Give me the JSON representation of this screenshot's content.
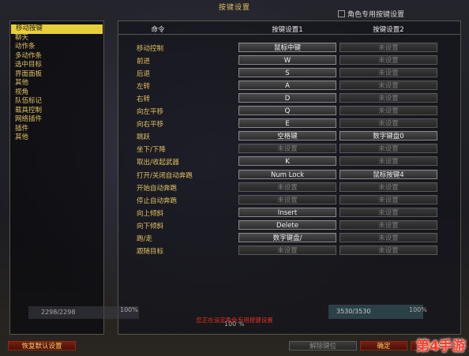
{
  "window_title": "按键设置",
  "role_keybind_label": "角色专用按键设置",
  "categories": [
    "移动按键",
    "聊天",
    "动作条",
    "多动作条",
    "选中目标",
    "界面面板",
    "其他",
    "视角",
    "队伍标记",
    "载具控制",
    "网络插件",
    "插件",
    "其他"
  ],
  "selected_category_index": 0,
  "table": {
    "headers": [
      "命令",
      "按键设置1",
      "按键设置2"
    ],
    "rows": [
      {
        "command": "移动控制",
        "key1": "鼠标中键",
        "key2": "未设置"
      },
      {
        "command": "前进",
        "key1": "W",
        "key2": "未设置"
      },
      {
        "command": "后退",
        "key1": "S",
        "key2": "未设置"
      },
      {
        "command": "左转",
        "key1": "A",
        "key2": "未设置"
      },
      {
        "command": "右转",
        "key1": "D",
        "key2": "未设置"
      },
      {
        "command": "向左平移",
        "key1": "Q",
        "key2": "未设置"
      },
      {
        "command": "向右平移",
        "key1": "E",
        "key2": "未设置"
      },
      {
        "command": "跳跃",
        "key1": "空格键",
        "key2": "数字键盘0"
      },
      {
        "command": "坐下/下降",
        "key1": "未设置",
        "key2": "未设置"
      },
      {
        "command": "取出/收起武器",
        "key1": "K",
        "key2": "未设置"
      },
      {
        "command": "打开/关闭自动奔跑",
        "key1": "Num Lock",
        "key2": "鼠标按键4"
      },
      {
        "command": "开始自动奔跑",
        "key1": "未设置",
        "key2": "未设置"
      },
      {
        "command": "停止自动奔跑",
        "key1": "未设置",
        "key2": "未设置"
      },
      {
        "command": "向上倾斜",
        "key1": "Insert",
        "key2": "未设置"
      },
      {
        "command": "向下倾斜",
        "key1": "Delete",
        "key2": "未设置"
      },
      {
        "command": "跑/走",
        "key1": "数字键盘/",
        "key2": "未设置"
      },
      {
        "command": "跟随目标",
        "key1": "未设置",
        "key2": "未设置"
      }
    ]
  },
  "empty_value": "未设置",
  "hud": {
    "left_value": "2298/2298",
    "left_pct": "100%",
    "center_pct": "100 %",
    "right_value": "3530/3530",
    "right_pct": "100%"
  },
  "warning": "您正在设定角色专用按键设置",
  "buttons": {
    "restore_defaults": "恢复默认设置",
    "unbind": "解除键位",
    "ok": "确定",
    "cancel": "取消"
  },
  "watermark": "第4手游"
}
